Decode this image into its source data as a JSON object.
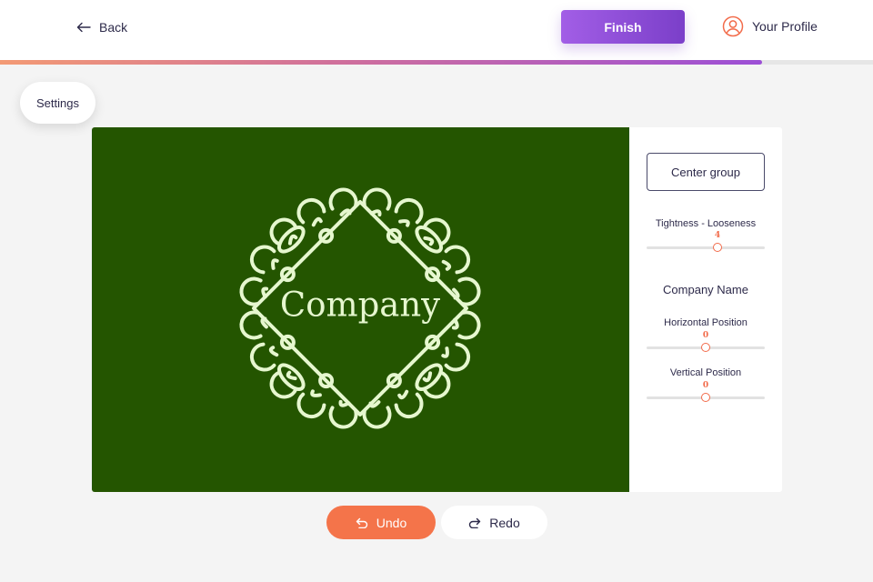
{
  "header": {
    "back_label": "Back",
    "finish_label": "Finish",
    "profile_label": "Your Profile",
    "progress": 0.873
  },
  "toolbar": {
    "settings_label": "Settings"
  },
  "canvas": {
    "background": "#245500",
    "ornament_color": "#e6f7cf",
    "company_text": "Company"
  },
  "panel": {
    "center_group_label": "Center group",
    "tightness": {
      "label": "Tightness - Looseness",
      "value": "4",
      "fraction": 0.6
    },
    "company_name_title": "Company Name",
    "horizontal": {
      "label": "Horizontal Position",
      "value": "0",
      "fraction": 0.5
    },
    "vertical": {
      "label": "Vertical Position",
      "value": "0",
      "fraction": 0.5
    }
  },
  "actions": {
    "undo_label": "Undo",
    "redo_label": "Redo"
  },
  "colors": {
    "accent_orange": "#f4744a",
    "accent_purple": "#8a4bd6",
    "text_dark": "#2d2a4a"
  },
  "icons": {
    "back": "arrow-left-icon",
    "profile": "user-circle-icon",
    "undo": "undo-arrow-icon",
    "redo": "redo-arrow-icon"
  }
}
